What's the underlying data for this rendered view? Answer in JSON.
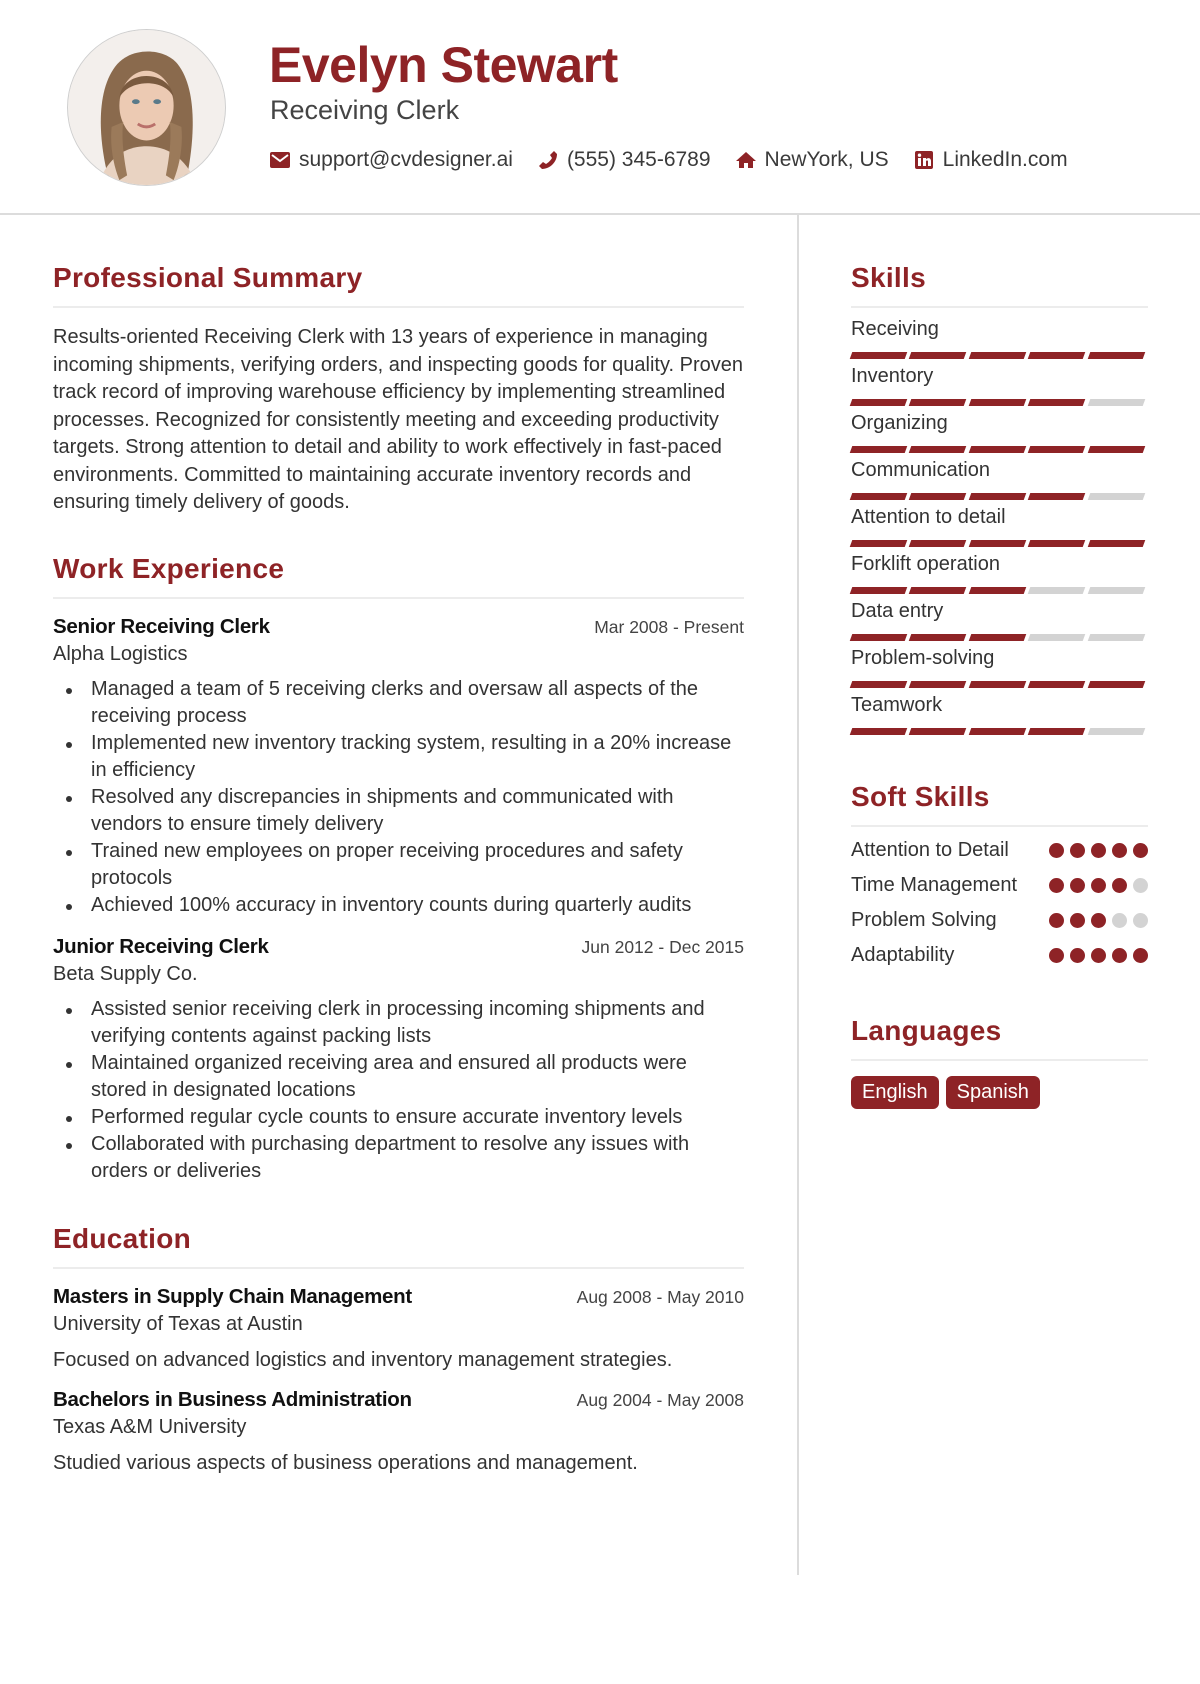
{
  "header": {
    "name": "Evelyn Stewart",
    "role": "Receiving Clerk",
    "contacts": [
      {
        "icon": "envelope-icon",
        "text": "support@cvdesigner.ai"
      },
      {
        "icon": "phone-icon",
        "text": "(555) 345-6789"
      },
      {
        "icon": "home-icon",
        "text": "NewYork, US"
      },
      {
        "icon": "linkedin-icon",
        "text": "LinkedIn.com"
      }
    ]
  },
  "colors": {
    "accent": "#8e2326",
    "inactive": "#d3d3d3",
    "rule": "#ececec"
  },
  "summary": {
    "title": "Professional Summary",
    "text": "Results-oriented Receiving Clerk with 13 years of experience in managing incoming shipments, verifying orders, and inspecting goods for quality. Proven track record of improving warehouse efficiency by implementing streamlined processes. Recognized for consistently meeting and exceeding productivity targets. Strong attention to detail and ability to work effectively in fast-paced environments. Committed to maintaining accurate inventory records and ensuring timely delivery of goods."
  },
  "experience": {
    "title": "Work Experience",
    "jobs": [
      {
        "title": "Senior Receiving Clerk",
        "date": "Mar 2008 - Present",
        "org": "Alpha Logistics",
        "bullets": [
          "Managed a team of 5 receiving clerks and oversaw all aspects of the receiving process",
          "Implemented new inventory tracking system, resulting in a 20% increase in efficiency",
          "Resolved any discrepancies in shipments and communicated with vendors to ensure timely delivery",
          "Trained new employees on proper receiving procedures and safety protocols",
          "Achieved 100% accuracy in inventory counts during quarterly audits"
        ]
      },
      {
        "title": "Junior Receiving Clerk",
        "date": "Jun 2012 - Dec 2015",
        "org": "Beta Supply Co.",
        "bullets": [
          "Assisted senior receiving clerk in processing incoming shipments and verifying contents against packing lists",
          "Maintained organized receiving area and ensured all products were stored in designated locations",
          "Performed regular cycle counts to ensure accurate inventory levels",
          "Collaborated with purchasing department to resolve any issues with orders or deliveries"
        ]
      }
    ]
  },
  "education": {
    "title": "Education",
    "items": [
      {
        "degree": "Masters in Supply Chain Management",
        "date": "Aug 2008 - May 2010",
        "school": "University of Texas at Austin",
        "desc": "Focused on advanced logistics and inventory management strategies."
      },
      {
        "degree": "Bachelors in Business Administration",
        "date": "Aug 2004 - May 2008",
        "school": "Texas A&M University",
        "desc": "Studied various aspects of business operations and management."
      }
    ]
  },
  "skills": {
    "title": "Skills",
    "max": 5,
    "items": [
      {
        "name": "Receiving",
        "level": 5
      },
      {
        "name": "Inventory",
        "level": 4
      },
      {
        "name": "Organizing",
        "level": 5
      },
      {
        "name": "Communication",
        "level": 4
      },
      {
        "name": "Attention to detail",
        "level": 5
      },
      {
        "name": "Forklift operation",
        "level": 3
      },
      {
        "name": "Data entry",
        "level": 3
      },
      {
        "name": "Problem-solving",
        "level": 5
      },
      {
        "name": "Teamwork",
        "level": 4
      }
    ]
  },
  "soft_skills": {
    "title": "Soft Skills",
    "max": 5,
    "items": [
      {
        "name": "Attention to Detail",
        "level": 5
      },
      {
        "name": "Time Management",
        "level": 4
      },
      {
        "name": "Problem Solving",
        "level": 3
      },
      {
        "name": "Adaptability",
        "level": 5
      }
    ]
  },
  "languages": {
    "title": "Languages",
    "items": [
      "English",
      "Spanish"
    ]
  }
}
